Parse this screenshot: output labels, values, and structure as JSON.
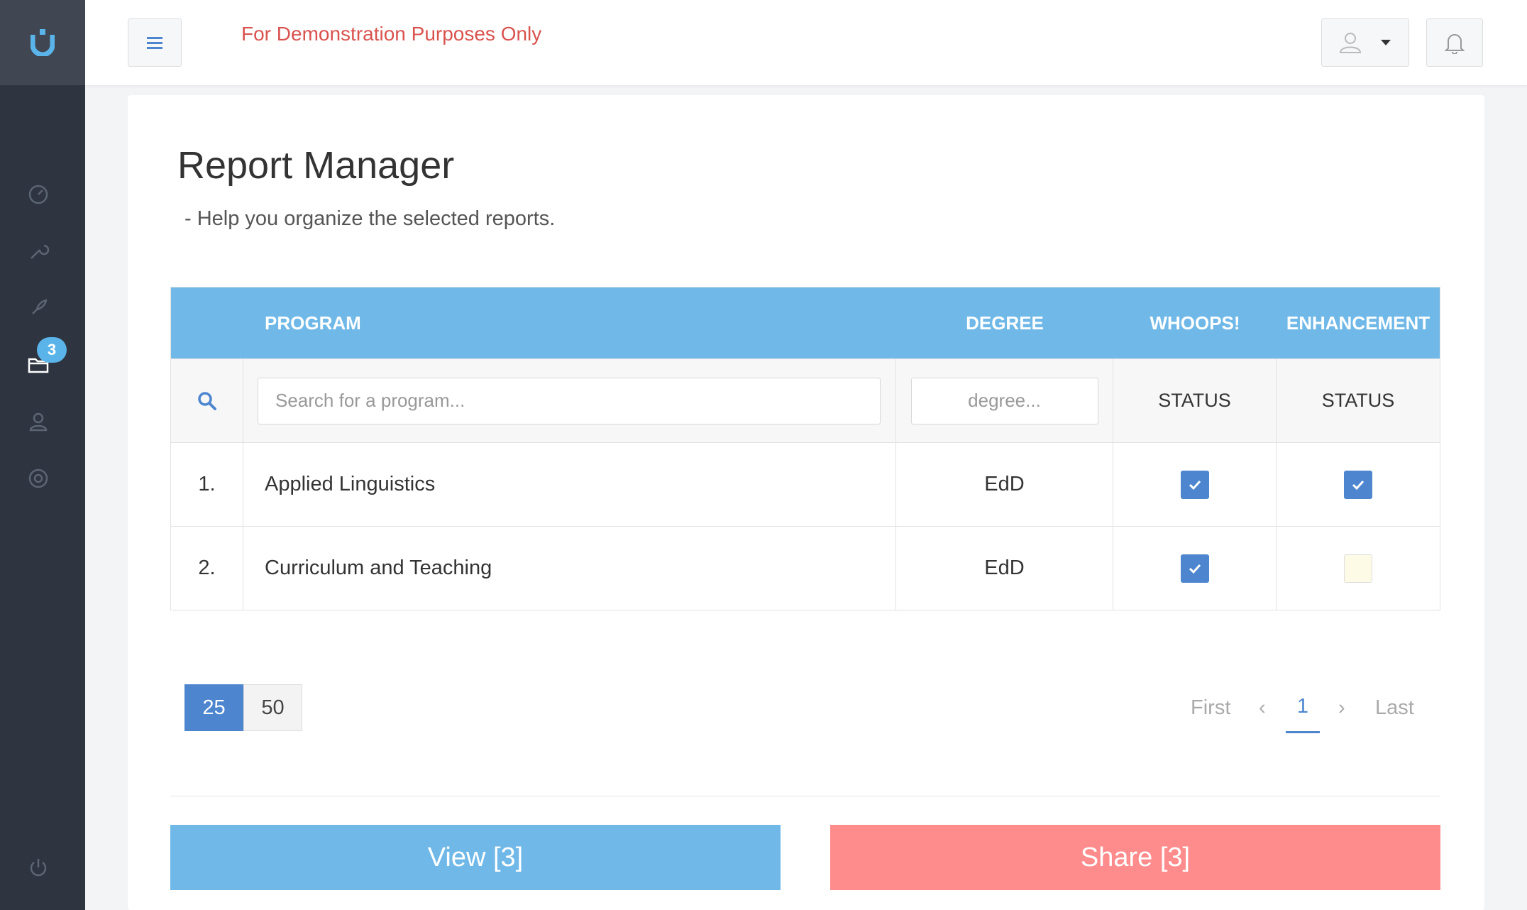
{
  "header": {
    "demo_notice": "For Demonstration Purposes Only",
    "logo_letter": "U"
  },
  "sidebar": {
    "items": [
      {
        "icon": "dashboard-icon"
      },
      {
        "icon": "wrench-icon"
      },
      {
        "icon": "rocket-icon"
      },
      {
        "icon": "folder-icon",
        "badge": "3"
      },
      {
        "icon": "user-icon"
      },
      {
        "icon": "lifebuoy-icon"
      }
    ],
    "footer_icon": "power-icon"
  },
  "page": {
    "title": "Report Manager",
    "subtitle": "- Help you organize the selected reports."
  },
  "table": {
    "columns": {
      "program": "PROGRAM",
      "degree": "DEGREE",
      "whoops": "WHOOPS!",
      "enhancement": "ENHANCEMENT"
    },
    "filters": {
      "program_placeholder": "Search for a program...",
      "degree_placeholder": "degree...",
      "whoops_status": "STATUS",
      "enhancement_status": "STATUS"
    },
    "rows": [
      {
        "num": "1.",
        "program": "Applied Linguistics",
        "degree": "EdD",
        "whoops": true,
        "enhancement": true
      },
      {
        "num": "2.",
        "program": "Curriculum and Teaching",
        "degree": "EdD",
        "whoops": true,
        "enhancement": false
      }
    ]
  },
  "pagination": {
    "page_sizes": [
      "25",
      "50"
    ],
    "active_size": "25",
    "first": "First",
    "prev": "‹",
    "current": "1",
    "next": "›",
    "last": "Last"
  },
  "actions": {
    "view": "View [3]",
    "share": "Share [3]"
  },
  "colors": {
    "accent": "#6fb8e7",
    "primary": "#4d86cf",
    "danger": "#ff8c8c",
    "sidebar": "#2e3440",
    "notice": "#d9534f"
  }
}
